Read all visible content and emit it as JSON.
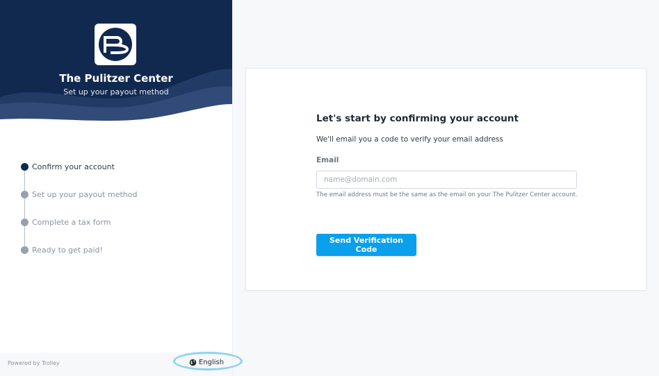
{
  "org": {
    "name": "The Pulitzer Center",
    "subtitle": "Set up your payout method",
    "logo_icon": "pulitzer-logo-icon"
  },
  "steps": [
    {
      "label": "Confirm your account",
      "active": true
    },
    {
      "label": "Set up your payout method",
      "active": false
    },
    {
      "label": "Complete a tax form",
      "active": false
    },
    {
      "label": "Ready to get paid!",
      "active": false
    }
  ],
  "footer": {
    "powered_by": "Powered by Trolley",
    "language": "English",
    "language_icon": "globe-icon"
  },
  "form": {
    "title": "Let's start by confirming your account",
    "description": "We'll email you a code to verify your email address",
    "email_label": "Email",
    "email_value": "",
    "email_placeholder": "name@domain.com",
    "hint": "The email address must be the same as the email on your The Pulitzer Center account.",
    "submit_label": "Send Verification Code"
  },
  "colors": {
    "brand_navy": "#12294f",
    "button_blue": "#0ba0ec",
    "highlight": "#8fd3ee"
  }
}
